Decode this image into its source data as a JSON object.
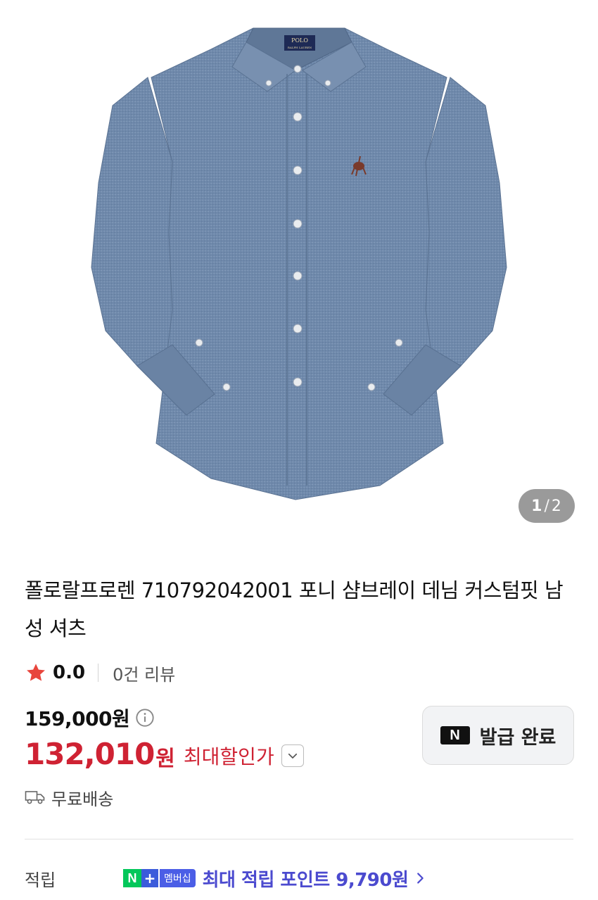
{
  "gallery": {
    "image_alt": "shirt-product-image",
    "current_page": "1",
    "page_separator": "/",
    "total_pages": "2",
    "collar_label_line1": "POLO",
    "collar_label_line2": "RALPH LAUREN"
  },
  "product": {
    "title": "폴로랄프로렌 710792042001 포니 샴브레이 데님 커스텀핏 남성 셔츠"
  },
  "rating": {
    "score": "0.0",
    "review_count": "0건 리뷰"
  },
  "price": {
    "original": "159,000원",
    "sale_value": "132,010",
    "sale_unit": "원",
    "sale_label": "최대할인가"
  },
  "coupon": {
    "logo_letter": "N",
    "label": "발급 완료"
  },
  "shipping": {
    "label": "무료배송"
  },
  "points": {
    "label": "적립",
    "badge_n": "N",
    "badge_plus": "+",
    "badge_text": "멤버십",
    "text": "최대 적립 포인트 9,790원"
  },
  "colors": {
    "accent_red": "#cf2233",
    "points_purple": "#4b4acf",
    "naver_green": "#03c75a",
    "shirt_blue": "#6f89ab"
  }
}
